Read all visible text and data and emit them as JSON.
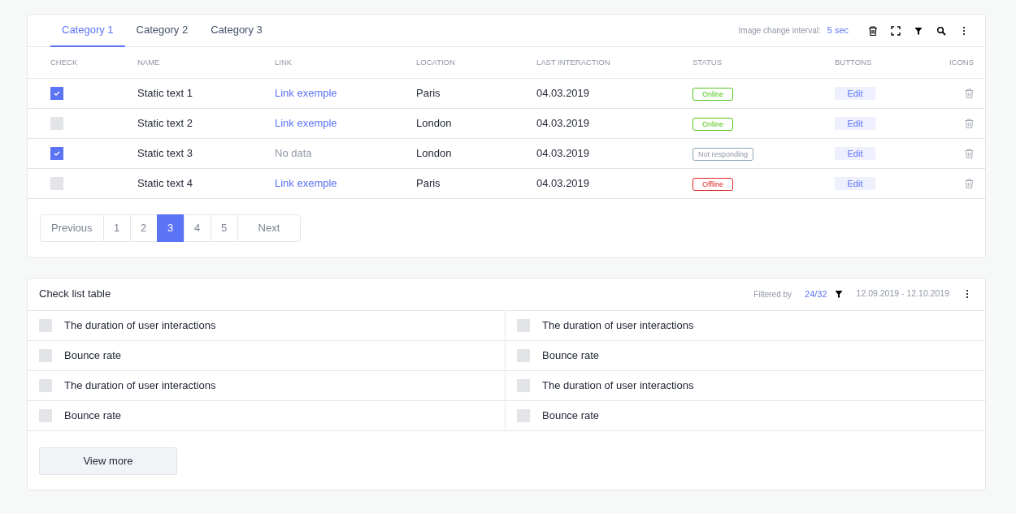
{
  "tabs": [
    {
      "label": "Category 1",
      "selected": true
    },
    {
      "label": "Category 2",
      "selected": false
    },
    {
      "label": "Category 3",
      "selected": false
    }
  ],
  "toolbar": {
    "interval_label": "Image change interval:",
    "interval_value": "5 sec"
  },
  "table": {
    "columns": [
      "CHECK",
      "NAME",
      "LINK",
      "LOCATION",
      "LAST INTERACTION",
      "STATUS",
      "BUTTONS",
      "ICONS"
    ],
    "rows": [
      {
        "checked": true,
        "name": "Static text 1",
        "link": {
          "text": "Link exemple",
          "kind": "link"
        },
        "location": "Paris",
        "last_interaction": "04.03.2019",
        "status": {
          "text": "Online",
          "kind": "online"
        },
        "button": "Edit"
      },
      {
        "checked": false,
        "name": "Static text 2",
        "link": {
          "text": "Link exemple",
          "kind": "link"
        },
        "location": "London",
        "last_interaction": "04.03.2019",
        "status": {
          "text": "Online",
          "kind": "online"
        },
        "button": "Edit"
      },
      {
        "checked": true,
        "name": "Static text 3",
        "link": {
          "text": "No data",
          "kind": "empty"
        },
        "location": "London",
        "last_interaction": "04.03.2019",
        "status": {
          "text": "Not responding",
          "kind": "warning"
        },
        "button": "Edit"
      },
      {
        "checked": false,
        "name": "Static text 4",
        "link": {
          "text": "Link exemple",
          "kind": "link"
        },
        "location": "Paris",
        "last_interaction": "04.03.2019",
        "status": {
          "text": "Offline",
          "kind": "offline"
        },
        "button": "Edit"
      }
    ]
  },
  "pagination": [
    {
      "label": "Previous",
      "selected": false
    },
    {
      "label": "1",
      "selected": false
    },
    {
      "label": "2",
      "selected": false
    },
    {
      "label": "3",
      "selected": true
    },
    {
      "label": "4",
      "selected": false
    },
    {
      "label": "5",
      "selected": false
    },
    {
      "label": "Next",
      "selected": false
    }
  ],
  "checklist": {
    "title": "Check list table",
    "filter_label": "Filtered by",
    "filter_value": "24/32",
    "date_range": "12.09.2019 - 12.10.2019",
    "items": [
      {
        "label": "The duration of user interactions",
        "checked": false
      },
      {
        "label": "The duration of user interactions",
        "checked": false
      },
      {
        "label": "Bounce rate",
        "checked": false
      },
      {
        "label": "Bounce rate",
        "checked": false
      },
      {
        "label": "The duration of user interactions",
        "checked": false
      },
      {
        "label": "The duration of user interactions",
        "checked": false
      },
      {
        "label": "Bounce rate",
        "checked": false
      },
      {
        "label": "Bounce rate",
        "checked": false
      }
    ],
    "button": "View more"
  }
}
